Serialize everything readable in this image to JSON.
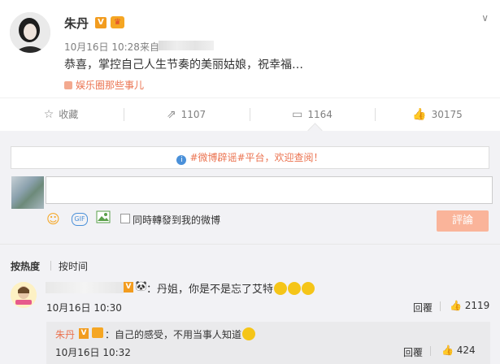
{
  "post": {
    "author": "朱丹",
    "verified_badge": "V",
    "time": "10月16日 10:28",
    "from_label": "来自",
    "text": "恭喜，掌控自己人生节奏的美丽姑娘，祝幸福…",
    "source": "娱乐圈那些事儿"
  },
  "actions": {
    "favorite": "收藏",
    "repost_count": "1107",
    "comment_count": "1164",
    "like_count": "30175"
  },
  "comment_box": {
    "notice": "#微博辟谣#平台，欢迎查阅！",
    "repost_checkbox_label": "同時轉發到我的微博",
    "submit_label": "評論",
    "input_value": ""
  },
  "sort": {
    "hot": "按热度",
    "time": "按时间"
  },
  "comments": [
    {
      "verified_badge": "V",
      "text": "：丹姐，你是不是忘了艾特",
      "time": "10月16日 10:30",
      "reply_label": "回覆",
      "like_count": "2119"
    }
  ],
  "sub_reply": {
    "author": "朱丹",
    "verified_badge": "V",
    "text": "：自己的感受，不用当事人知道",
    "time": "10月16日 10:32",
    "reply_label": "回覆",
    "like_count": "424"
  },
  "colors": {
    "accent": "#eb7350",
    "badge": "#f29c1f",
    "submit_bg": "#fab49a",
    "comment_bg": "#f2f2f5"
  }
}
